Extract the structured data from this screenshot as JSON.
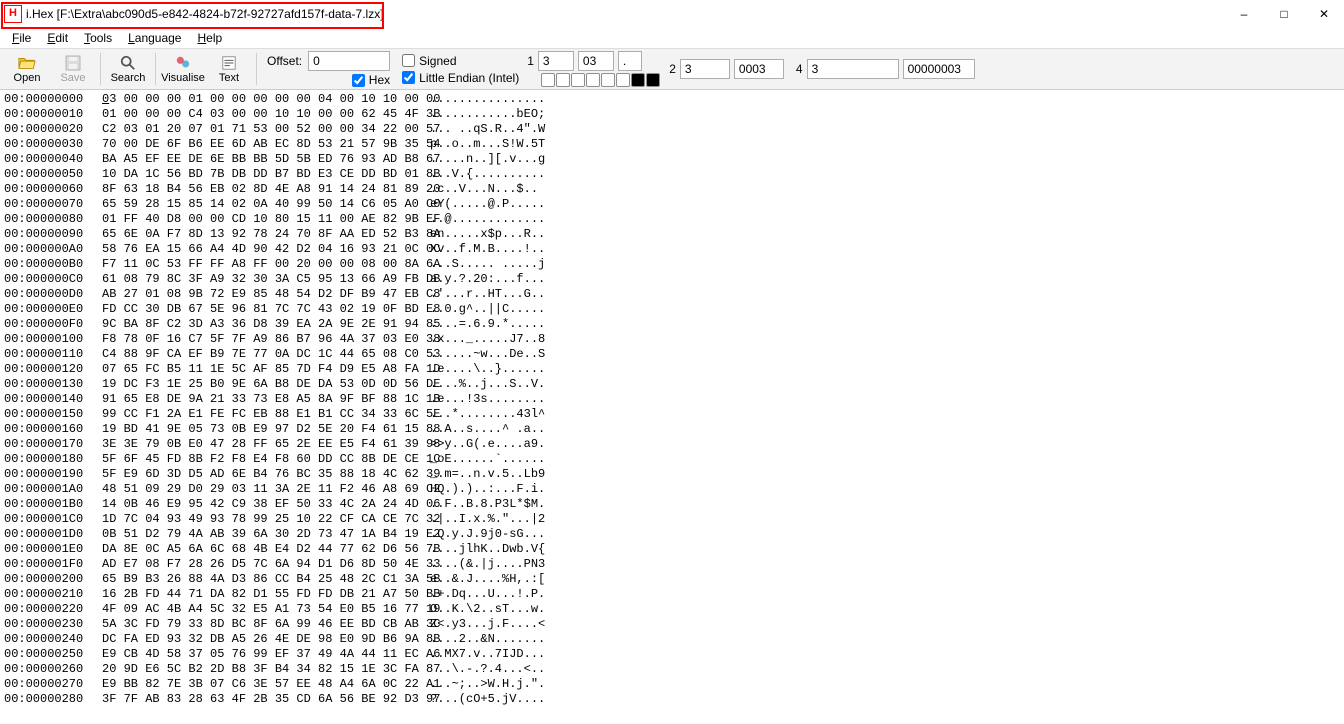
{
  "titlebar": {
    "app_icon_letter": "H",
    "title": "i.Hex [F:\\Extra\\abc090d5-e842-4824-b72f-92727afd157f-data-7.lzx]"
  },
  "menus": [
    "File",
    "Edit",
    "Tools",
    "Language",
    "Help"
  ],
  "toolbar": {
    "buttons": [
      {
        "name": "open",
        "label": "Open"
      },
      {
        "name": "save",
        "label": "Save"
      },
      {
        "name": "search",
        "label": "Search"
      },
      {
        "name": "visualise",
        "label": "Visualise"
      },
      {
        "name": "text",
        "label": "Text"
      }
    ],
    "offset_label": "Offset:",
    "offset_value": "0",
    "hex_label": "Hex",
    "hex_checked": true,
    "signed_label": "Signed",
    "signed_checked": false,
    "endian_label": "Little Endian (Intel)",
    "endian_checked": true,
    "fields": [
      {
        "idx": "1",
        "a": "3",
        "b": "03",
        "bits": 2
      },
      {
        "idx": "2",
        "a": "3",
        "b": "0003",
        "bits": 4
      },
      {
        "idx": "4",
        "a": "3",
        "b": "00000003",
        "bits": 0
      }
    ],
    "dot_label": "."
  },
  "hex_rows": [
    {
      "off": "00:00000000",
      "hex": "03 00 00 00 01 00 00 00 00 00 04 00 10 10 00 00",
      "asc": "................"
    },
    {
      "off": "00:00000010",
      "hex": "01 00 00 00 C4 03 00 00 10 10 00 00 62 45 4F 3B",
      "asc": "............bEO;"
    },
    {
      "off": "00:00000020",
      "hex": "C2 03 01 20 07 01 71 53 00 52 00 00 34 22 00 57",
      "asc": "... ..qS.R..4\".W"
    },
    {
      "off": "00:00000030",
      "hex": "70 00 DE 6F B6 EE 6D AB EC 8D 53 21 57 9B 35 54",
      "asc": "p..o..m...S!W.5T"
    },
    {
      "off": "00:00000040",
      "hex": "BA A5 EF EE DE 6E BB BB 5D 5B ED 76 93 AD B8 67",
      "asc": ".....n..][.v...g"
    },
    {
      "off": "00:00000050",
      "hex": "10 DA 1C 56 BD 7B DB DD B7 BD E3 CE DD BD 01 8B",
      "asc": "...V.{.........."
    },
    {
      "off": "00:00000060",
      "hex": "8F 63 18 B4 56 EB 02 8D 4E A8 91 14 24 81 89 20",
      "asc": ".c..V...N...$.. "
    },
    {
      "off": "00:00000070",
      "hex": "65 59 28 15 85 14 02 0A 40 99 50 14 C6 05 A0 C0",
      "asc": "eY(.....@.P....."
    },
    {
      "off": "00:00000080",
      "hex": "01 FF 40 D8 00 00 CD 10 80 15 11 00 AE 82 9B EF",
      "asc": "..@............."
    },
    {
      "off": "00:00000090",
      "hex": "65 6E 0A F7 8D 13 92 78 24 70 8F AA ED 52 B3 8A",
      "asc": "en.....x$p...R.."
    },
    {
      "off": "00:000000A0",
      "hex": "58 76 EA 15 66 A4 4D 90 42 D2 04 16 93 21 0C 0C",
      "asc": "Xv..f.M.B....!.."
    },
    {
      "off": "00:000000B0",
      "hex": "F7 11 0C 53 FF FF A8 FF 00 20 00 00 08 00 8A 6A",
      "asc": "...S..... .....j"
    },
    {
      "off": "00:000000C0",
      "hex": "61 08 79 8C 3F A9 32 30 3A C5 95 13 66 A9 FB DB",
      "asc": "a.y.?.20:...f..."
    },
    {
      "off": "00:000000D0",
      "hex": "AB 27 01 08 9B 72 E9 85 48 54 D2 DF B9 47 EB C8",
      "asc": ".'...r..HT...G.."
    },
    {
      "off": "00:000000E0",
      "hex": "FD CC 30 DB 67 5E 96 81 7C 7C 43 02 19 0F BD E8",
      "asc": "..0.g^..||C....."
    },
    {
      "off": "00:000000F0",
      "hex": "9C BA 8F C2 3D A3 36 D8 39 EA 2A 9E 2E 91 94 85",
      "asc": "....=.6.9.*....."
    },
    {
      "off": "00:00000100",
      "hex": "F8 78 0F 16 C7 5F 7F A9 86 B7 96 4A 37 03 E0 38",
      "asc": ".x..._.....J7..8"
    },
    {
      "off": "00:00000110",
      "hex": "C4 88 9F CA EF B9 7E 77 0A DC 1C 44 65 08 C0 53",
      "asc": "......~w...De..S"
    },
    {
      "off": "00:00000120",
      "hex": "07 65 FC B5 11 1E 5C AF 85 7D F4 D9 E5 A8 FA 1D",
      "asc": ".e....\\..}......"
    },
    {
      "off": "00:00000130",
      "hex": "19 DC F3 1E 25 B0 9E 6A B8 DE DA 53 0D 0D 56 DE",
      "asc": "....%..j...S..V."
    },
    {
      "off": "00:00000140",
      "hex": "91 65 E8 DE 9A 21 33 73 E8 A5 8A 9F BF 88 1C 1B",
      "asc": ".e...!3s........"
    },
    {
      "off": "00:00000150",
      "hex": "99 CC F1 2A E1 FE FC EB 88 E1 B1 CC 34 33 6C 5E",
      "asc": "...*........43l^"
    },
    {
      "off": "00:00000160",
      "hex": "19 BD 41 9E 05 73 0B E9 97 D2 5E 20 F4 61 15 88",
      "asc": "..A..s....^ .a.."
    },
    {
      "off": "00:00000170",
      "hex": "3E 3E 79 0B E0 47 28 FF 65 2E EE E5 F4 61 39 98",
      "asc": ">>y..G(.e....a9."
    },
    {
      "off": "00:00000180",
      "hex": "5F 6F 45 FD 8B F2 F8 E4 F8 60 DD CC 8B DE CE 1C",
      "asc": "_oE......`......"
    },
    {
      "off": "00:00000190",
      "hex": "5F E9 6D 3D D5 AD 6E B4 76 BC 35 88 18 4C 62 39",
      "asc": "_.m=..n.v.5..Lb9"
    },
    {
      "off": "00:000001A0",
      "hex": "48 51 09 29 D0 29 03 11 3A 2E 11 F2 46 A8 69 C2",
      "asc": "HQ.).)..:...F.i."
    },
    {
      "off": "00:000001B0",
      "hex": "14 0B 46 E9 95 42 C9 38 EF 50 33 4C 2A 24 4D 06",
      "asc": "..F..B.8.P3L*$M."
    },
    {
      "off": "00:000001C0",
      "hex": "1D 7C 04 93 49 93 78 99 25 10 22 CF CA CE 7C 32",
      "asc": ".|..I.x.%.\"...|2"
    },
    {
      "off": "00:000001D0",
      "hex": "0B 51 D2 79 4A AB 39 6A 30 2D 73 47 1A B4 19 E2",
      "asc": ".Q.y.J.9j0-sG..."
    },
    {
      "off": "00:000001E0",
      "hex": "DA 8E 0C A5 6A 6C 68 4B E4 D2 44 77 62 D6 56 7B",
      "asc": "....jlhK..Dwb.V{"
    },
    {
      "off": "00:000001F0",
      "hex": "AD E7 08 F7 28 26 D5 7C 6A 94 D1 D6 8D 50 4E 33",
      "asc": "....(&.|j....PN3"
    },
    {
      "off": "00:00000200",
      "hex": "65 B9 B3 26 88 4A D3 86 CC B4 25 48 2C C1 3A 5B",
      "asc": "e..&.J....%H,.:["
    },
    {
      "off": "00:00000210",
      "hex": "16 2B FD 44 71 DA 82 D1 55 FD FD DB 21 A7 50 BB",
      "asc": ".+.Dq...U...!.P."
    },
    {
      "off": "00:00000220",
      "hex": "4F 09 AC 4B A4 5C 32 E5 A1 73 54 E0 B5 16 77 19",
      "asc": "O..K.\\2..sT...w."
    },
    {
      "off": "00:00000230",
      "hex": "5A 3C FD 79 33 8D BC 8F 6A 99 46 EE BD CB AB 3C",
      "asc": "Z<.y3...j.F....<"
    },
    {
      "off": "00:00000240",
      "hex": "DC FA ED 93 32 DB A5 26 4E DE 98 E0 9D B6 9A 8B",
      "asc": "....2..&N......."
    },
    {
      "off": "00:00000250",
      "hex": "E9 CB 4D 58 37 05 76 99 EF 37 49 4A 44 11 EC A6",
      "asc": "..MX7.v..7IJD..."
    },
    {
      "off": "00:00000260",
      "hex": "20 9D E6 5C B2 2D B8 3F B4 34 82 15 1E 3C FA 87",
      "asc": " ..\\.-.?.4...<.."
    },
    {
      "off": "00:00000270",
      "hex": "E9 BB 82 7E 3B 07 C6 3E 57 EE 48 A4 6A 0C 22 A1",
      "asc": "...~;..>W.H.j.\"."
    },
    {
      "off": "00:00000280",
      "hex": "3F 7F AB 83 28 63 4F 2B 35 CD 6A 56 BE 92 D3 97",
      "asc": "?...(cO+5.jV...."
    }
  ]
}
